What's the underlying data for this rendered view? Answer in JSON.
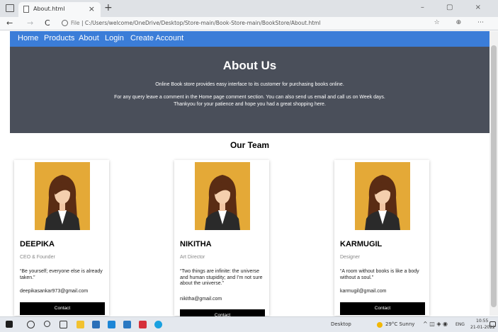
{
  "browser": {
    "tab_title": "About.html",
    "tab_close": "×",
    "new_tab": "+",
    "window_controls": "– ▢ ×",
    "back": "←",
    "forward": "→",
    "reload": "C",
    "url_label": "File",
    "url": "C:/Users/welcome/OneDrive/Desktop/Store-main/Book-Store-main/BookStore/About.html",
    "toolbar_icons": "☆ ⊕ ⋯"
  },
  "nav": {
    "items": [
      "Home",
      "Products",
      "About",
      "Login",
      "Create Account"
    ]
  },
  "about": {
    "title": "About Us",
    "line1": "Online Book store provides easy interface to its customer for purchasing books online.",
    "line2": "For any query leave a comment in the Home page comment section. You can also send us email and call us on Week days.",
    "line3": "Thankyou for your patience and hope you had a great shopping here."
  },
  "team": {
    "title": "Our Team",
    "members": [
      {
        "name": "DEEPIKA",
        "role": "CEO & Founder",
        "quote": "“Be yourself; everyone else is already taken.”",
        "email": "deepikasankar973@gmail.com",
        "button": "Contact"
      },
      {
        "name": "NIKITHA",
        "role": "Art Director",
        "quote": "“Two things are infinite: the universe and human stupidity; and I'm not sure about the universe.”",
        "email": "nikitha@gmail.com",
        "button": "Contact"
      },
      {
        "name": "KARMUGIL",
        "role": "Designer",
        "quote": "“A room without books is like a body without a soul.”",
        "email": "karmugil@gmail.com",
        "button": "Contact"
      }
    ]
  },
  "taskbar": {
    "desktop_label": "Desktop",
    "weather": "29°C Sunny",
    "language": "ENG",
    "time": "10:55",
    "date": "21-01-2022"
  },
  "colors": {
    "nav_blue": "#3b7dd8",
    "about_bg": "#4a4f5a",
    "avatar_bg": "#e4a937"
  }
}
